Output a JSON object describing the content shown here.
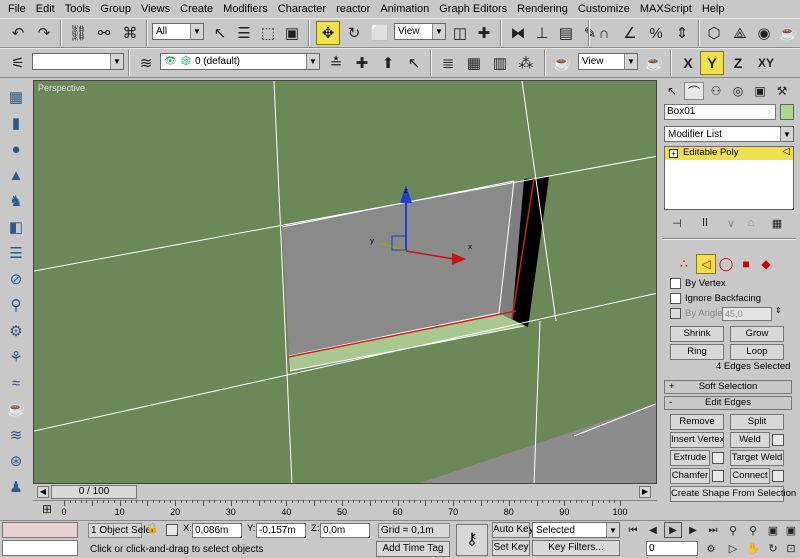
{
  "menu": [
    "File",
    "Edit",
    "Tools",
    "Group",
    "Views",
    "Create",
    "Modifiers",
    "Character",
    "reactor",
    "Animation",
    "Graph Editors",
    "Rendering",
    "Customize",
    "MAXScript",
    "Help"
  ],
  "toolbar1": {
    "filter_value": "All",
    "refcoord_value": "View"
  },
  "toolbar2": {
    "layer_value": "0 (default)",
    "view_value": "View",
    "axis": [
      "X",
      "Y",
      "Z",
      "XY"
    ]
  },
  "viewport": {
    "label": "Perspective"
  },
  "command_panel": {
    "object_name": "Box01",
    "modifier_list": "Modifier List",
    "stack_item": "Editable Poly",
    "by_vertex": "By Vertex",
    "ignore_backfacing": "Ignore Backfacing",
    "by_angle": "By Angle:",
    "angle_value": "45,0",
    "shrink": "Shrink",
    "grow": "Grow",
    "ring": "Ring",
    "loop": "Loop",
    "selection_status": "4 Edges Selected",
    "soft_selection": "Soft Selection",
    "edit_edges": "Edit Edges",
    "remove": "Remove",
    "split": "Split",
    "insert_vertex": "Insert Vertex",
    "weld": "Weld",
    "extrude": "Extrude",
    "target_weld": "Target Weld",
    "chamfer": "Chamfer",
    "connect": "Connect",
    "create_shape": "Create Shape From Selection",
    "plus": "+",
    "minus": "-"
  },
  "timeline": {
    "frame": "0 / 100",
    "ticks": [
      "0",
      "10",
      "20",
      "30",
      "40",
      "50",
      "60",
      "70",
      "80",
      "90",
      "100"
    ]
  },
  "status": {
    "selection": "1 Object Sele",
    "x_label": "X:",
    "x_value": "0,086m",
    "y_label": "Y:",
    "y_value": "-0,157m",
    "z_label": "Z:",
    "z_value": "0,0m",
    "grid": "Grid = 0,1m",
    "prompt": "Click or click-and-drag to select objects",
    "add_time_tag": "Add Time Tag",
    "auto_key": "Auto Key",
    "set_key": "Set Key",
    "key_mode": "Selected",
    "key_filters": "Key Filters...",
    "frame_field": "0"
  },
  "colors": {
    "viewport_bg": "#6b8859",
    "active_yellow": "#f0e04a",
    "plane_grey": "#8c8c8c",
    "highlight_green": "#a8c890"
  }
}
